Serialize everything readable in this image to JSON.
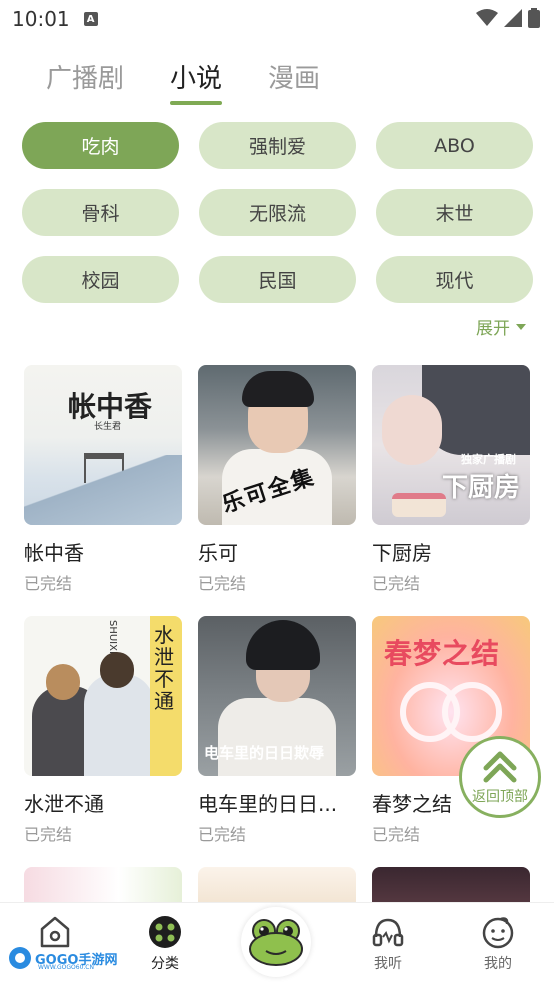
{
  "status_bar": {
    "time": "10:01",
    "notification_badge": "A"
  },
  "top_tabs": [
    {
      "label": "广播剧",
      "active": false
    },
    {
      "label": "小说",
      "active": true
    },
    {
      "label": "漫画",
      "active": false
    }
  ],
  "tags": [
    {
      "label": "吃肉",
      "active": true
    },
    {
      "label": "强制爱",
      "active": false
    },
    {
      "label": "ABO",
      "active": false
    },
    {
      "label": "骨科",
      "active": false
    },
    {
      "label": "无限流",
      "active": false
    },
    {
      "label": "末世",
      "active": false
    },
    {
      "label": "校园",
      "active": false
    },
    {
      "label": "民国",
      "active": false
    },
    {
      "label": "现代",
      "active": false
    }
  ],
  "expand_label": "展开",
  "books": [
    {
      "title": "帐中香",
      "status": "已完结",
      "cover_text": "帐中香",
      "cover_sub": "长生君"
    },
    {
      "title": "乐可",
      "status": "已完结",
      "cover_text": "乐可全集"
    },
    {
      "title": "下厨房",
      "status": "已完结",
      "cover_small": "独家广播剧",
      "cover_text": "下厨房"
    },
    {
      "title": "水泄不通",
      "status": "已完结",
      "cover_text": "水泄不通",
      "cover_side": "SHUIXIEBUTONG"
    },
    {
      "title": "电车里的日日...",
      "status": "已完结",
      "cover_text": "电车里的日日欺辱"
    },
    {
      "title": "春梦之结",
      "status": "已完结",
      "cover_text": "春梦之结"
    }
  ],
  "back_to_top_label": "返回顶部",
  "bottom_nav": {
    "items": [
      {
        "label": "",
        "icon": "home-icon"
      },
      {
        "label": "分类",
        "icon": "category-icon"
      },
      {
        "label": "",
        "icon": "frog-icon"
      },
      {
        "label": "我听",
        "icon": "headphones-icon"
      },
      {
        "label": "我的",
        "icon": "profile-icon"
      }
    ]
  },
  "watermark": {
    "text": "GOGO手游网",
    "sub": "WWW.GOGO60.CN"
  },
  "colors": {
    "accent": "#7ea657",
    "tag_bg": "#d8e6c8",
    "muted": "#9a9a9a"
  }
}
